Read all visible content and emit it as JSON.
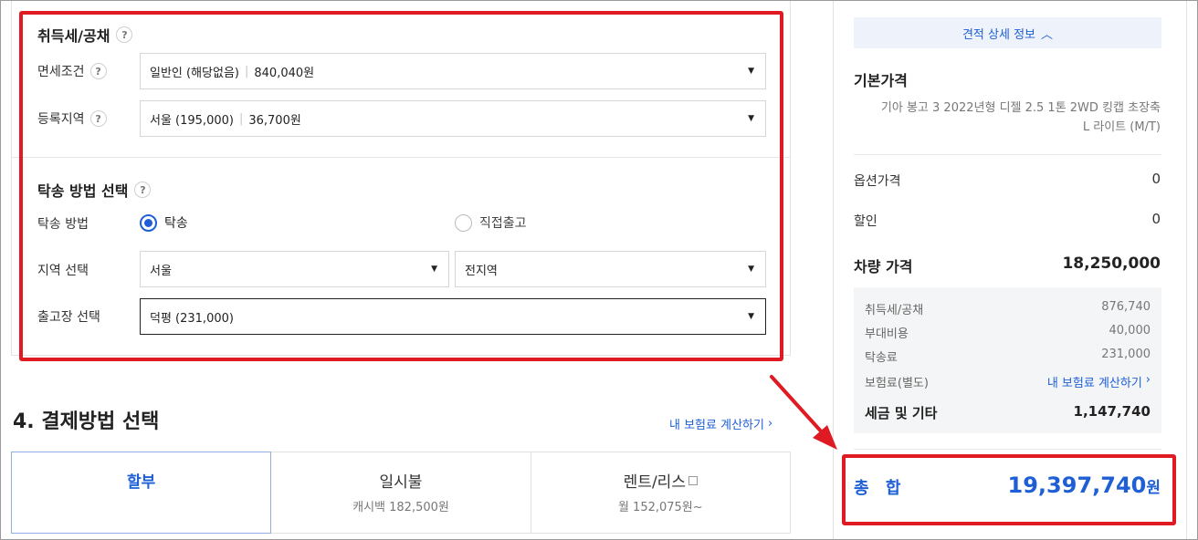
{
  "tax": {
    "section_title": "취득세/공채",
    "exemption": {
      "label": "면세조건",
      "value": "일반인 (해당없음)",
      "amount": "840,040원"
    },
    "region": {
      "label": "등록지역",
      "value": "서울 (195,000)",
      "amount": "36,700원"
    }
  },
  "delivery": {
    "section_title": "탁송 방법 선택",
    "method_label": "탁송 방법",
    "options": [
      "탁송",
      "직접출고"
    ],
    "selected_option": "탁송",
    "area_label": "지역 선택",
    "area_value": "서울",
    "area_sub_value": "전지역",
    "depot_label": "출고장 선택",
    "depot_value": "덕평 (231,000)"
  },
  "payment": {
    "title": "4. 결제방법 선택",
    "insurance_link": "내 보험료 계산하기",
    "tabs": [
      {
        "name": "할부",
        "sub": ""
      },
      {
        "name": "일시불",
        "sub": "캐시백 182,500원"
      },
      {
        "name": "렌트/리스",
        "sub": "월 152,075원~"
      }
    ],
    "selected_tab": "할부"
  },
  "summary": {
    "detail_toggle": "견적 상세 정보",
    "base_price_label": "기본가격",
    "car_model_line1": "기아 봉고 3 2022년형 디젤 2.5 1톤 2WD 킹캡 초장축",
    "car_model_line2": "L 라이트 (M/T)",
    "option_price_label": "옵션가격",
    "option_price_value": "0",
    "discount_label": "할인",
    "discount_value": "0",
    "vehicle_price_label": "차량 가격",
    "vehicle_price_value": "18,250,000",
    "fees": {
      "acq_tax_label": "취득세/공채",
      "acq_tax_value": "876,740",
      "extra_label": "부대비용",
      "extra_value": "40,000",
      "delivery_label": "탁송료",
      "delivery_value": "231,000",
      "insurance_label": "보험료(별도)",
      "insurance_link": "내 보험료 계산하기",
      "total_label": "세금 및 기타",
      "total_value": "1,147,740"
    },
    "grand_total_label": "총 합",
    "grand_total_value": "19,397,740",
    "grand_total_unit": "원"
  },
  "colors": {
    "accent": "#1e5fd6",
    "highlight": "#e01a22"
  }
}
